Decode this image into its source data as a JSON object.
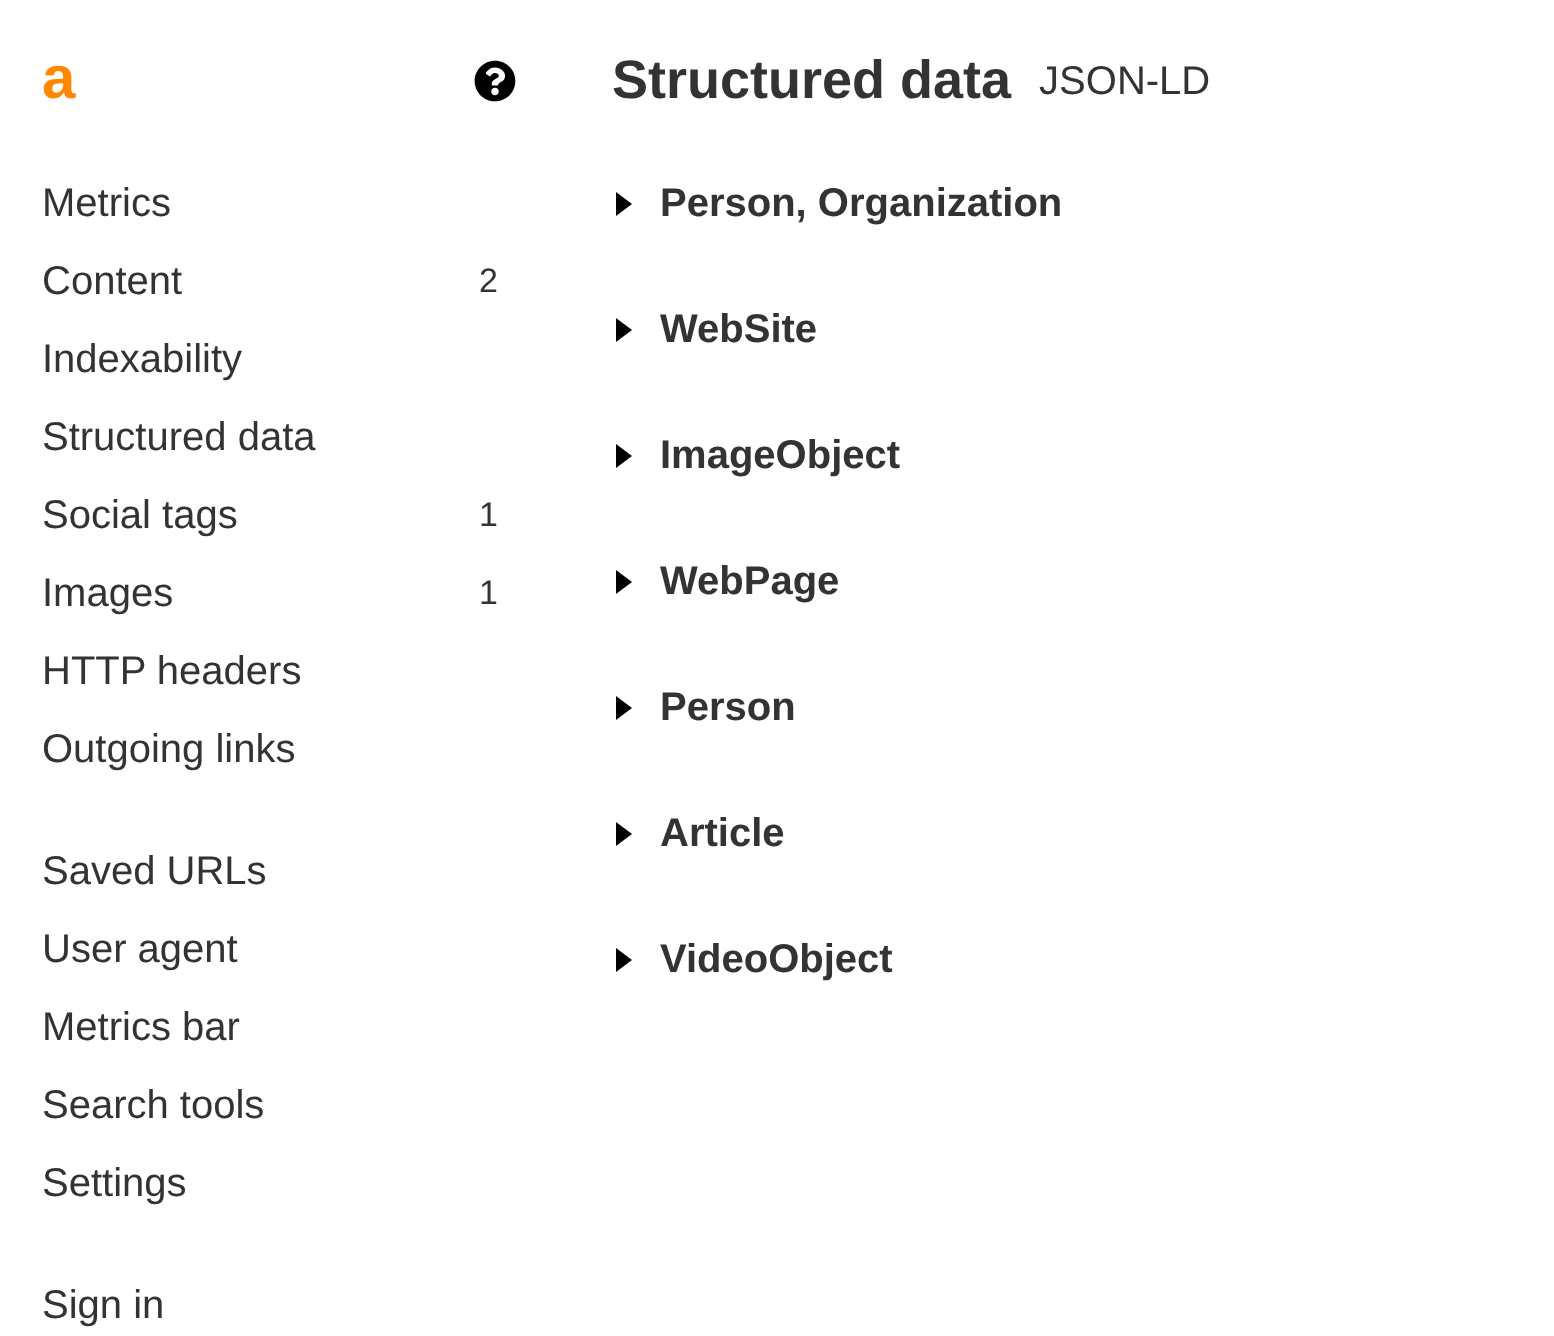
{
  "logo": "a",
  "sidebar": {
    "groups": [
      {
        "items": [
          {
            "label": "Metrics"
          },
          {
            "label": "Content",
            "count": "2"
          },
          {
            "label": "Indexability"
          },
          {
            "label": "Structured data"
          },
          {
            "label": "Social tags",
            "count": "1"
          },
          {
            "label": "Images",
            "count": "1"
          },
          {
            "label": "HTTP headers"
          },
          {
            "label": "Outgoing links"
          }
        ]
      },
      {
        "items": [
          {
            "label": "Saved URLs"
          },
          {
            "label": "User agent"
          },
          {
            "label": "Metrics bar"
          },
          {
            "label": "Search tools"
          },
          {
            "label": "Settings"
          }
        ]
      },
      {
        "items": [
          {
            "label": "Sign in"
          }
        ]
      }
    ]
  },
  "main": {
    "title": "Structured data",
    "format": "JSON-LD",
    "sections": [
      {
        "label": "Person, Organization",
        "expanded": false
      },
      {
        "label": "WebSite",
        "expanded": false
      },
      {
        "label": "ImageObject",
        "expanded": false
      },
      {
        "label": "WebPage",
        "expanded": false
      },
      {
        "label": "Person",
        "expanded": false
      },
      {
        "label": "Article",
        "expanded": false
      },
      {
        "label": "VideoObject",
        "expanded": false
      }
    ]
  }
}
